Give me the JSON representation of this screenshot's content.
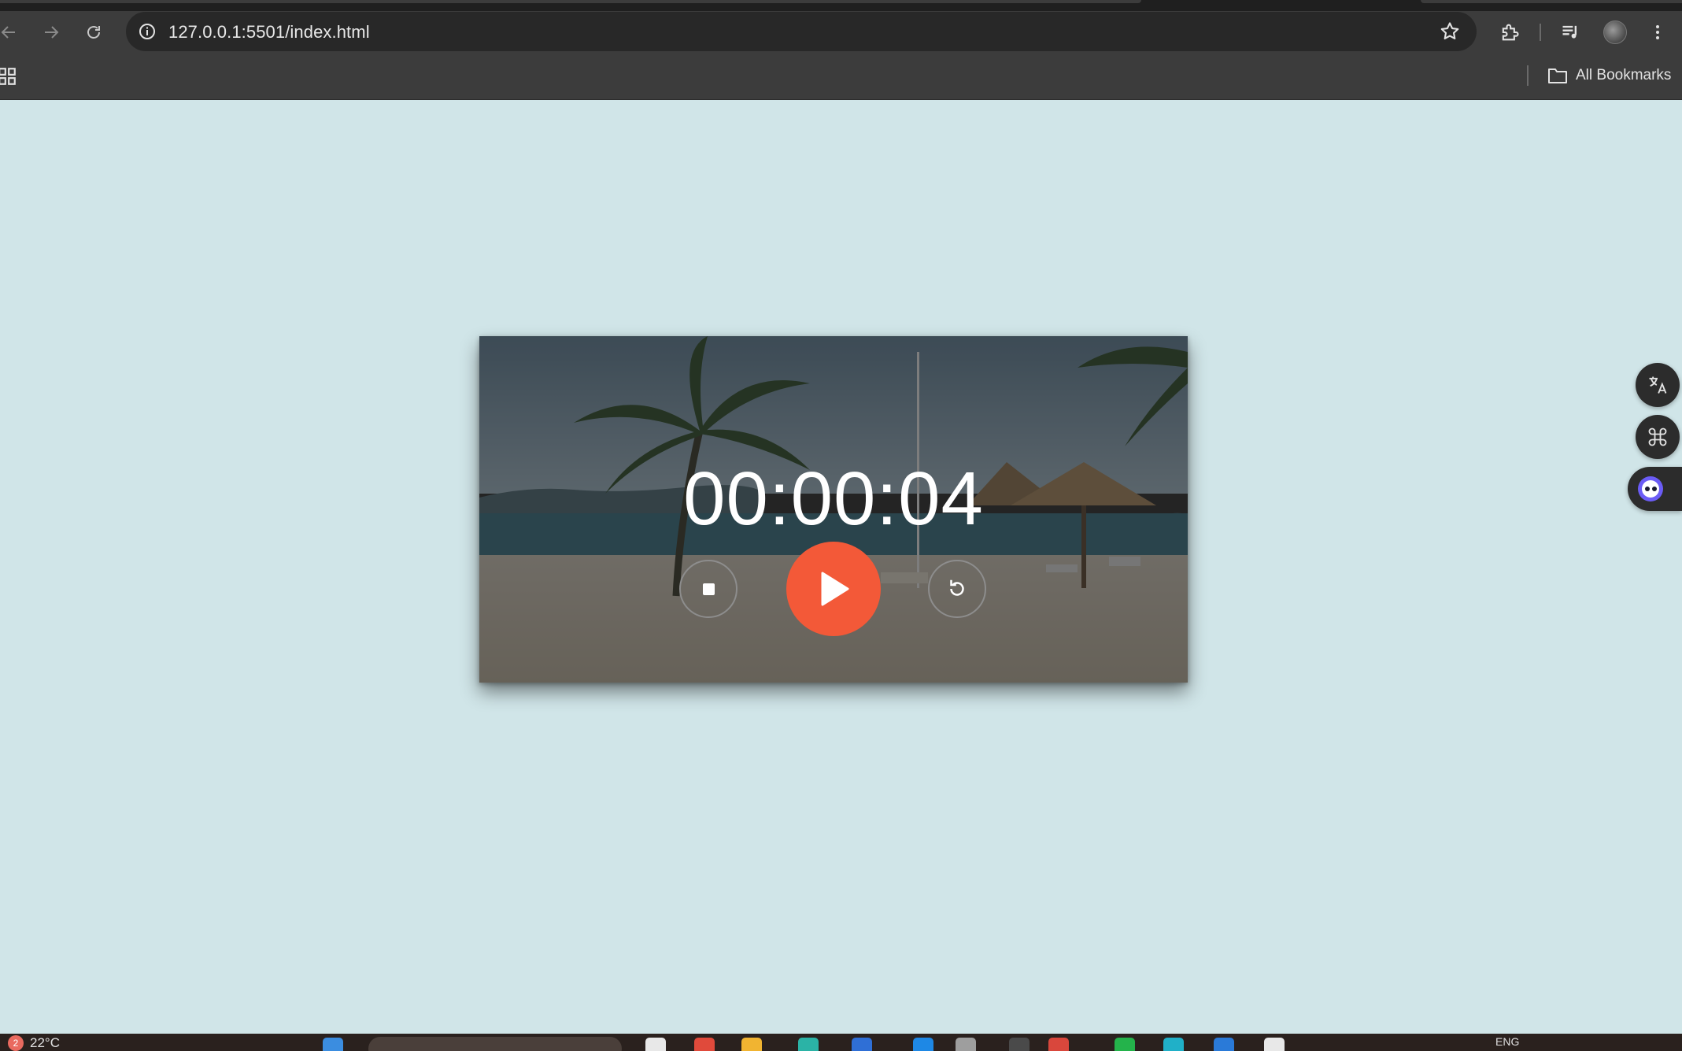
{
  "browser": {
    "url": "127.0.0.1:5501/index.html",
    "bookmarks_label": "All Bookmarks",
    "icons": {
      "back": "arrow-left-icon",
      "forward": "arrow-right-icon",
      "reload": "reload-icon",
      "site_info": "info-icon",
      "bookmark_star": "star-icon",
      "extensions": "puzzle-icon",
      "media": "media-queue-icon",
      "profile": "avatar",
      "menu": "kebab-icon",
      "apps": "apps-grid-icon",
      "folder": "folder-icon"
    }
  },
  "timer": {
    "time": "00:00:04",
    "controls": {
      "stop": "stop-icon",
      "play": "play-icon",
      "reset": "reset-icon"
    },
    "colors": {
      "play_button": "#f35938",
      "page_background": "#d0e5e8"
    }
  },
  "side_widgets": [
    "translate-icon",
    "command-icon",
    "assistant-icon"
  ],
  "taskbar": {
    "temperature": "22°C",
    "notification_count": "2",
    "language": "ENG"
  }
}
